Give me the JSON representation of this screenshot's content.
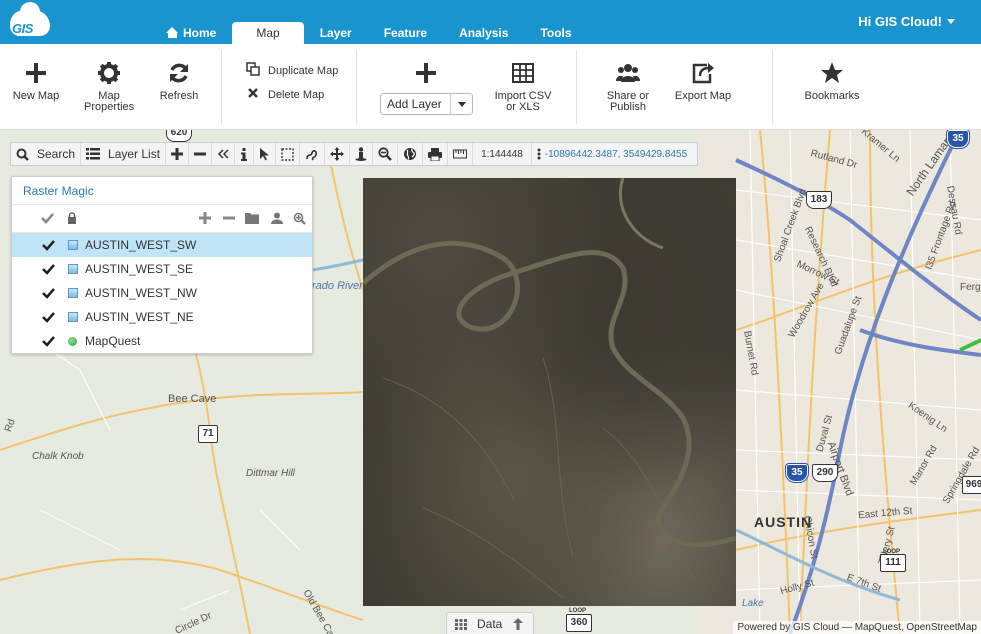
{
  "app": {
    "logo_text": "GIS",
    "user_greeting": "Hi GIS Cloud!"
  },
  "nav": {
    "tabs": [
      {
        "label": "Home",
        "active": false
      },
      {
        "label": "Map",
        "active": true
      },
      {
        "label": "Layer",
        "active": false
      },
      {
        "label": "Feature",
        "active": false
      },
      {
        "label": "Analysis",
        "active": false
      },
      {
        "label": "Tools",
        "active": false
      }
    ]
  },
  "ribbon": {
    "new_map": "New Map",
    "map_properties": "Map Properties",
    "refresh": "Refresh",
    "duplicate_map": "Duplicate Map",
    "delete_map": "Delete Map",
    "add_layer": "Add Layer",
    "import_csv": "Import CSV or XLS",
    "share_publish": "Share or Publish",
    "export_map": "Export Map",
    "bookmarks": "Bookmarks"
  },
  "map_toolbar": {
    "search": "Search",
    "layer_list": "Layer List",
    "scale": "1:144448",
    "coordinates": "-10896442.3487, 3549429.8455"
  },
  "layer_panel": {
    "title": "Raster Magic",
    "layers": [
      {
        "name": "AUSTIN_WEST_SW",
        "checked": true,
        "selected": true,
        "type": "raster"
      },
      {
        "name": "AUSTIN_WEST_SE",
        "checked": true,
        "selected": false,
        "type": "raster"
      },
      {
        "name": "AUSTIN_WEST_NW",
        "checked": true,
        "selected": false,
        "type": "raster"
      },
      {
        "name": "AUSTIN_WEST_NE",
        "checked": true,
        "selected": false,
        "type": "raster"
      },
      {
        "name": "MapQuest",
        "checked": true,
        "selected": false,
        "type": "basemap"
      }
    ]
  },
  "map_labels": {
    "colorado_river": "rado River",
    "bee_cave": "Bee Cave",
    "chalk_knob": "Chalk Knob",
    "dittmar_hill": "Dittmar Hill",
    "austin": "AUSTIN",
    "old_bee_cave": "Old Bee Cave Rd",
    "circle_dr": "Circle Dr",
    "rd": "Rd",
    "rutland": "Rutland Dr",
    "kramer": "Kramer Ln",
    "north_lamar": "North Lamar",
    "frontage": "I35 Frontage Rd",
    "dessau": "Dessau Rd",
    "research_blvd": "Research Blvd",
    "shoal_creek": "Shoal Creek Blvd",
    "morrow": "Morrow St",
    "woodrow": "Woodrow Ave",
    "guadalupe": "Guadalupe St",
    "burnet": "Burnet Rd",
    "duval": "Duval St",
    "airport": "Airport Blvd",
    "koenig": "Koenig Ln",
    "manor": "Manor Rd",
    "springdale": "Springdale Rd",
    "e12": "East 12th St",
    "chicon": "Chicon St",
    "holly": "Holly St",
    "tillery": "Tillery St",
    "e7": "E 7th St",
    "ferg": "Fergu",
    "lake": "Lake"
  },
  "shields": {
    "i35_top": "35",
    "us183": "183",
    "sh71": "71",
    "i35": "35",
    "us290": "290",
    "loop111": "111",
    "loop360": "360",
    "s969": "969",
    "r620": "620",
    "loop_label": "LOOP"
  },
  "bottom": {
    "data_tab": "Data",
    "attribution": "Powered by GIS Cloud — MapQuest, OpenStreetMap"
  },
  "colors": {
    "topbar": "#1a94cf",
    "selected_row": "#bfe4f6",
    "link": "#2a7ab0"
  }
}
